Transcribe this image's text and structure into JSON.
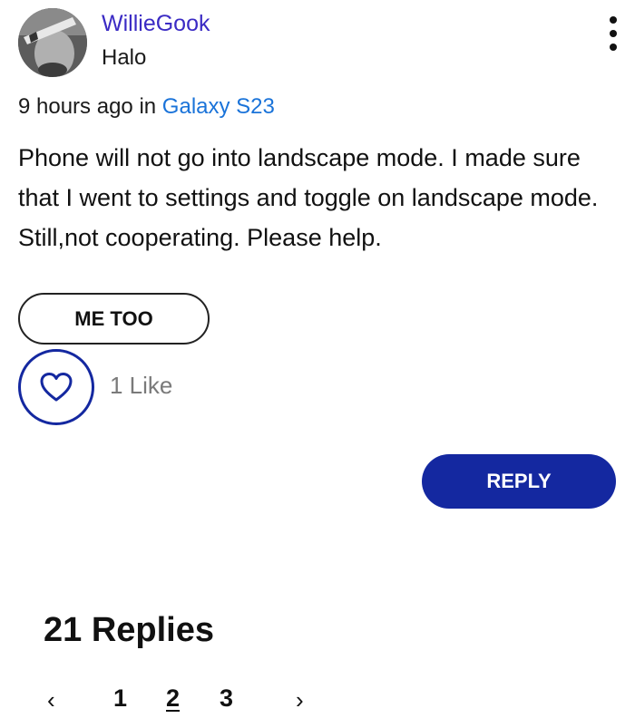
{
  "post": {
    "author": {
      "username": "WillieGook",
      "rank": "Halo",
      "avatar_icon": "user-avatar-photo"
    },
    "time_ago": "9 hours ago",
    "in_text": "in",
    "board": "Galaxy S23",
    "body": "Phone will not go into landscape mode. I made sure that I went to settings and toggle on landscape mode. Still,not cooperating. Please help.",
    "menu_icon": "more-vertical-icon"
  },
  "actions": {
    "me_too_label": "ME TOO",
    "like_icon": "heart-icon",
    "like_count_text": "1 Like",
    "reply_label": "REPLY"
  },
  "replies": {
    "heading": "21 Replies",
    "pagination": {
      "prev_icon": "chevron-left-icon",
      "next_icon": "chevron-right-icon",
      "pages": [
        "1",
        "2",
        "3"
      ],
      "current_page": "2"
    }
  },
  "colors": {
    "username": "#3b2bc4",
    "board_link": "#1a73d9",
    "primary": "#1428a0",
    "muted": "#7a7a7a"
  }
}
